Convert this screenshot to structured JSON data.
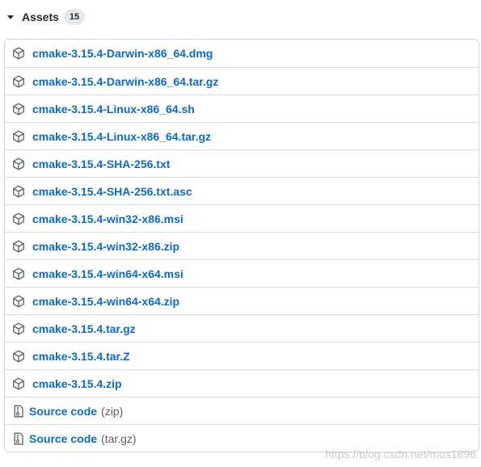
{
  "header": {
    "title": "Assets",
    "count": "15"
  },
  "assets": [
    {
      "name": "cmake-3.15.4-Darwin-x86_64.dmg",
      "icon": "package-icon"
    },
    {
      "name": "cmake-3.15.4-Darwin-x86_64.tar.gz",
      "icon": "package-icon"
    },
    {
      "name": "cmake-3.15.4-Linux-x86_64.sh",
      "icon": "package-icon"
    },
    {
      "name": "cmake-3.15.4-Linux-x86_64.tar.gz",
      "icon": "package-icon"
    },
    {
      "name": "cmake-3.15.4-SHA-256.txt",
      "icon": "package-icon"
    },
    {
      "name": "cmake-3.15.4-SHA-256.txt.asc",
      "icon": "package-icon"
    },
    {
      "name": "cmake-3.15.4-win32-x86.msi",
      "icon": "package-icon"
    },
    {
      "name": "cmake-3.15.4-win32-x86.zip",
      "icon": "package-icon"
    },
    {
      "name": "cmake-3.15.4-win64-x64.msi",
      "icon": "package-icon"
    },
    {
      "name": "cmake-3.15.4-win64-x64.zip",
      "icon": "package-icon"
    },
    {
      "name": "cmake-3.15.4.tar.gz",
      "icon": "package-icon"
    },
    {
      "name": "cmake-3.15.4.tar.Z",
      "icon": "package-icon"
    },
    {
      "name": "cmake-3.15.4.zip",
      "icon": "package-icon"
    }
  ],
  "source_code": [
    {
      "label": "Source code",
      "suffix": "(zip)",
      "icon": "file-zip-icon"
    },
    {
      "label": "Source code",
      "suffix": "(tar.gz)",
      "icon": "file-zip-icon"
    }
  ],
  "watermark": "https://blog.csdn.net/mos1896",
  "colors": {
    "link": "#0969da",
    "muted": "#57606a",
    "border": "#d0d7de",
    "badge_bg": "#e6e8eb"
  }
}
